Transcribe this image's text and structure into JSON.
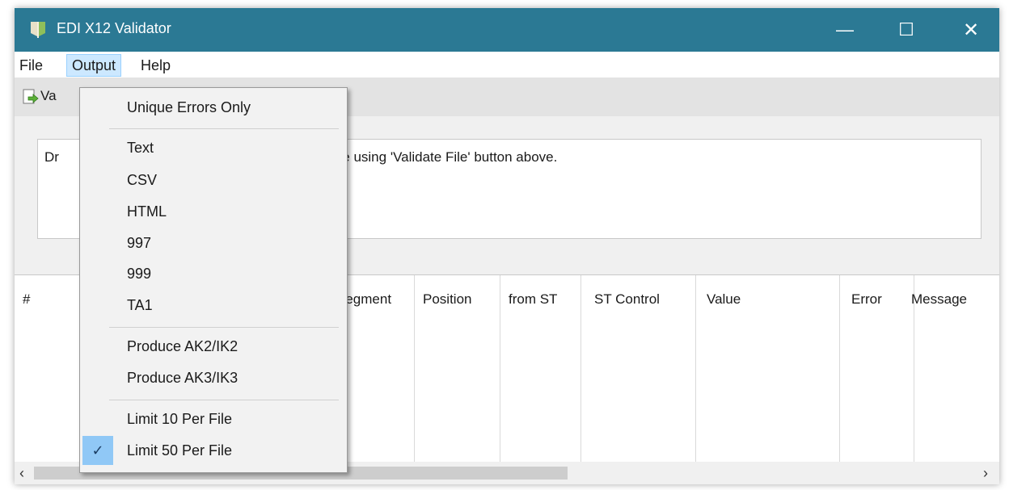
{
  "window": {
    "title": "EDI X12 Validator",
    "minimize": "—",
    "maximize": "☐",
    "close": "✕"
  },
  "menubar": {
    "file": "File",
    "output": "Output",
    "help": "Help"
  },
  "toolbar": {
    "validate_label": "Va"
  },
  "instruction": {
    "prefix": "Dr",
    "suffix": "file using 'Validate File' button above."
  },
  "grid": {
    "columns": [
      "#",
      "Segment",
      "Position",
      "from ST",
      "ST Control",
      "Value",
      "Error",
      "Message"
    ]
  },
  "scrollbar": {
    "left": "‹",
    "right": "›"
  },
  "dropdown": {
    "unique_errors": "Unique Errors Only",
    "text": "Text",
    "csv": "CSV",
    "html": "HTML",
    "f997": "997",
    "f999": "999",
    "ta1": "TA1",
    "ak2": "Produce AK2/IK2",
    "ak3": "Produce AK3/IK3",
    "limit10": "Limit 10 Per File",
    "limit50": "Limit 50 Per File",
    "checkmark": "✓"
  },
  "colors": {
    "titlebar": "#2b7994",
    "menu_highlight": "#cce8ff",
    "check_bg": "#90c8f6"
  }
}
